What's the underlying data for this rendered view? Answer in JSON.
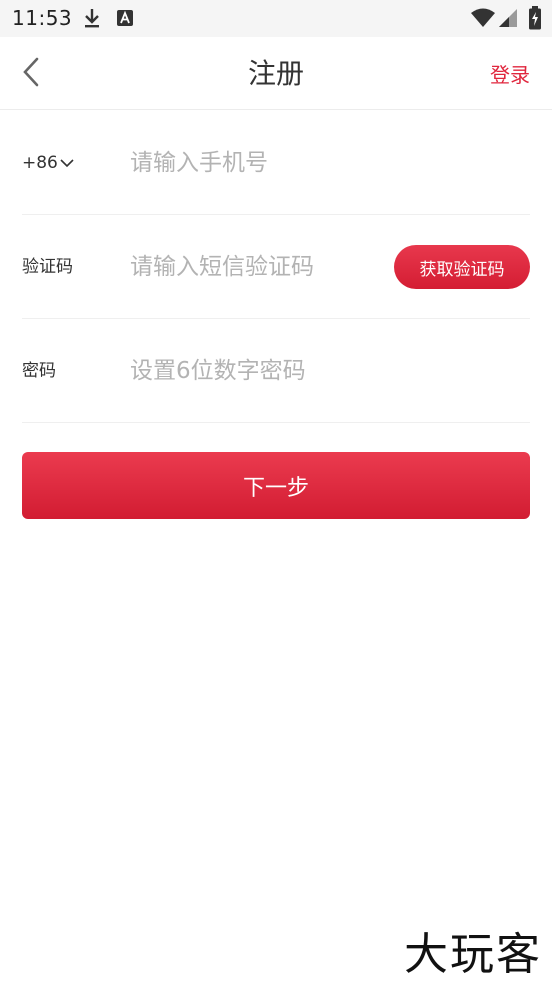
{
  "status_bar": {
    "time": "11:53",
    "icons": [
      "download-icon",
      "accessibility-a-icon",
      "wifi-icon",
      "signal-icon",
      "battery-charging-icon"
    ]
  },
  "nav": {
    "back_icon": "chevron-left-icon",
    "title": "注册",
    "login_label": "登录"
  },
  "form": {
    "phone": {
      "country_code": "+86",
      "placeholder": "请输入手机号"
    },
    "code": {
      "label": "验证码",
      "placeholder": "请输入短信验证码",
      "button_label": "获取验证码"
    },
    "password": {
      "label": "密码",
      "placeholder": "设置6位数字密码"
    },
    "next_label": "下一步"
  },
  "watermark": {
    "text": "大玩客"
  },
  "colors": {
    "accent": "#e0263d",
    "placeholder": "#b3b3b3",
    "divider": "#efefef",
    "status_bar_bg": "#f5f5f5"
  }
}
